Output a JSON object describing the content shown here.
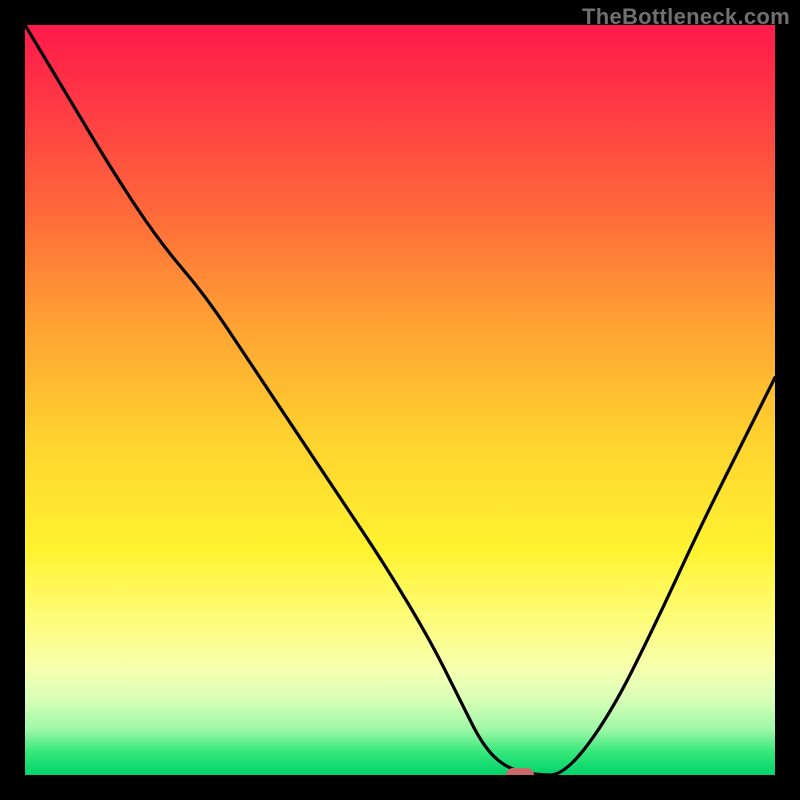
{
  "watermark": "TheBottleneck.com",
  "colors": {
    "bg_black": "#000000",
    "curve": "#000000",
    "marker": "#c96b6b",
    "watermark_text": "#707070",
    "gradient_top": "#ff1a4b",
    "gradient_bottom": "#00d36a"
  },
  "chart_data": {
    "type": "line",
    "title": "",
    "xlabel": "",
    "ylabel": "",
    "xlim": [
      0,
      100
    ],
    "ylim": [
      0,
      100
    ],
    "grid": false,
    "x": [
      0,
      6,
      12,
      18,
      24,
      30,
      36,
      42,
      48,
      54,
      58,
      61,
      64,
      68,
      72,
      78,
      84,
      90,
      96,
      100
    ],
    "values": [
      100,
      90,
      80,
      71,
      64,
      55,
      46,
      37,
      28,
      18,
      10,
      4,
      1,
      0,
      0,
      8,
      20,
      33,
      45,
      53
    ],
    "marker": {
      "x": 66,
      "y": 0
    },
    "notes": "Values are percent of plot height from the bottom edge (0 = bottom green strip, 100 = top red). Estimated from pixel positions; no axis ticks or labels are drawn."
  }
}
